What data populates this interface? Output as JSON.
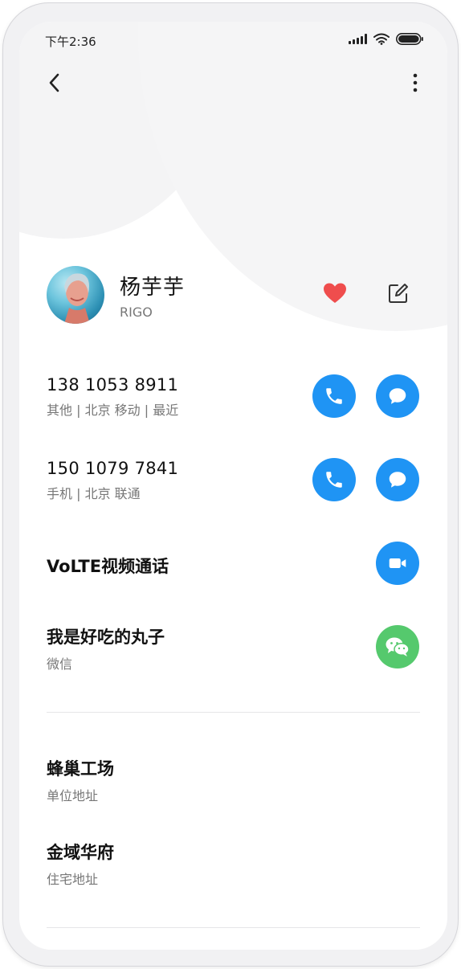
{
  "status_bar": {
    "time": "下午2:36"
  },
  "header": {
    "back_icon": "chevron-left-icon",
    "more_icon": "more-vertical-icon"
  },
  "contact": {
    "name": "杨芋芋",
    "company": "RIGO",
    "favorite_color": "#ef4d4d"
  },
  "phones": [
    {
      "number": "138 1053 8911",
      "detail": "其他 | 北京 移动 | 最近"
    },
    {
      "number": "150 1079 7841",
      "detail": "手机 | 北京 联通"
    }
  ],
  "volte": {
    "label": "VoLTE视频通话"
  },
  "wechat": {
    "name": "我是好吃的丸子",
    "label": "微信"
  },
  "addresses": [
    {
      "value": "蜂巢工场",
      "label": "单位地址"
    },
    {
      "value": "金域华府",
      "label": "住宅地址"
    }
  ],
  "colors": {
    "accent": "#1f94f4",
    "wechat": "#55c96d",
    "text_primary": "#111111",
    "text_secondary": "#777777"
  }
}
